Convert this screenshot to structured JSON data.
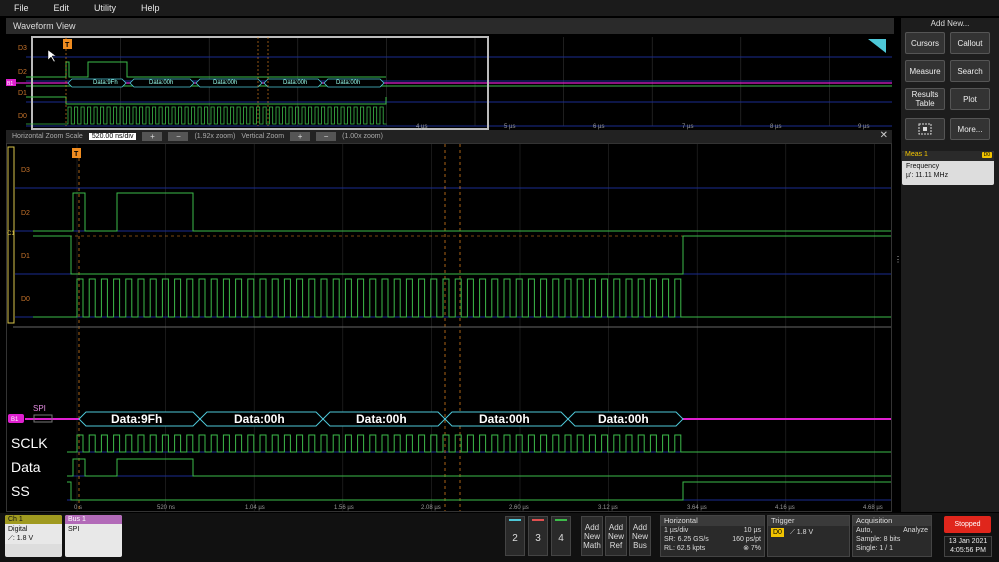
{
  "menu": [
    "File",
    "Edit",
    "Utility",
    "Help"
  ],
  "waveform_view": {
    "title": "Waveform View",
    "overview": {
      "channels": [
        "D3",
        "D2",
        "D1",
        "D0"
      ],
      "bus_labels": [
        "Data:9Fh",
        "Data:00h",
        "Data:00h",
        "Data:00h",
        "Data:00h"
      ],
      "time_ticks": [
        "4 µs",
        "5 µs",
        "6 µs",
        "7 µs",
        "8 µs",
        "9 µs"
      ],
      "bus_marker": "B1",
      "trigger_marker": "T"
    },
    "zoom_bar": {
      "h_label": "Horizontal Zoom Scale",
      "h_value": "520.00 ns/div",
      "h_zoom": "(1.92x zoom)",
      "v_label": "Vertical Zoom",
      "v_zoom": "(1.00x zoom)",
      "plus": "+",
      "minus": "−",
      "close": "✕"
    },
    "main": {
      "channels": [
        "D3",
        "D2",
        "D1",
        "D0"
      ],
      "ch_marker": "C1",
      "bus_marker": "B1",
      "bus_name": "SPI",
      "bus_labels": [
        "Data:9Fh",
        "Data:00h",
        "Data:00h",
        "Data:00h",
        "Data:00h"
      ],
      "signal_labels": [
        "SCLK",
        "Data",
        "SS"
      ],
      "time_ticks": [
        "0 s",
        "520 ns",
        "1.04 µs",
        "1.56 µs",
        "2.08 µs",
        "2.60 µs",
        "3.12 µs",
        "3.64 µs",
        "4.16 µs",
        "4.68 µs"
      ],
      "trigger_marker": "T"
    }
  },
  "right_panel": {
    "title": "Add New...",
    "buttons": [
      "Cursors",
      "Callout",
      "Measure",
      "Search",
      "Results Table",
      "Plot",
      "",
      "More..."
    ],
    "meas": {
      "title": "Meas 1",
      "badge": "D0",
      "name": "Frequency",
      "value": "µ': 11.11 MHz"
    }
  },
  "bottom": {
    "ch1": {
      "title": "Ch 1",
      "line1": "Digital",
      "line2": "⟋: 1.8 V"
    },
    "bus1": {
      "title": "Bus 1",
      "line1": "SPI"
    },
    "channel_buttons": [
      "2",
      "3",
      "4"
    ],
    "add_new": [
      "Add New Math",
      "Add New Ref",
      "Add New Bus"
    ],
    "horizontal": {
      "title": "Horizontal",
      "rows": [
        [
          "1 µs/div",
          "10 µs"
        ],
        [
          "SR: 6.25 GS/s",
          "160 ps/pt"
        ],
        [
          "RL: 62.5 kpts",
          "⊗ 7%"
        ]
      ]
    },
    "trigger": {
      "title": "Trigger",
      "src": "D0",
      "level": "⟋ 1.8 V"
    },
    "acquisition": {
      "title": "Acquisition",
      "rows": [
        [
          "Auto,",
          "Analyze"
        ],
        [
          "Sample: 8 bits",
          ""
        ],
        [
          "Single: 1 / 1",
          ""
        ]
      ]
    },
    "status": "Stopped",
    "date": "13 Jan 2021",
    "time": "4:05:56 PM"
  },
  "colors": {
    "d_channel_label": "#c8742b",
    "wave_green": "#3dbb4a",
    "bus_magenta": "#e020d0",
    "bus_cyan": "#4ec8d8",
    "grid_blue": "#1a2d8f",
    "trigger_orange": "#f08c20"
  }
}
